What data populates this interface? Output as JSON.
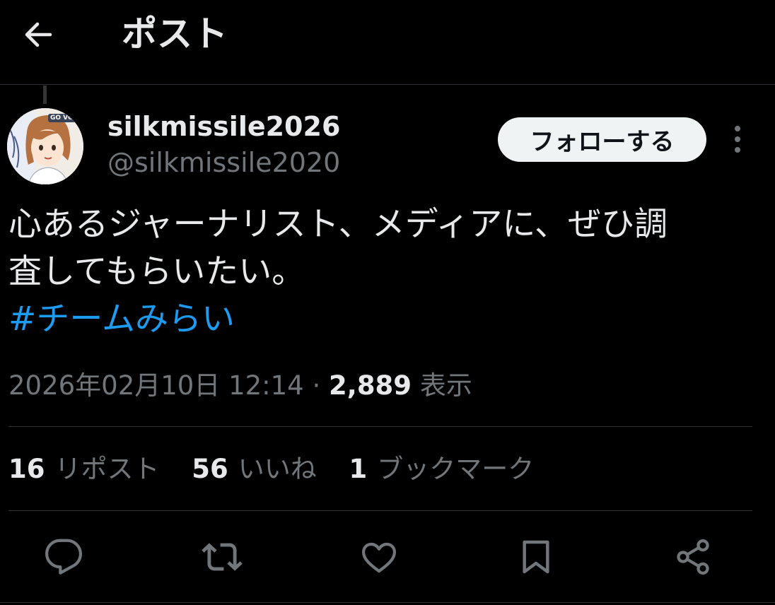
{
  "header": {
    "title": "ポスト",
    "back_icon": "arrow-left-icon"
  },
  "author": {
    "display_name": "silkmissile2026",
    "handle": "@silkmissile2020",
    "avatar_text": "GO VOTE"
  },
  "follow_button": {
    "label": "フォローする"
  },
  "post": {
    "text_line1": "心あるジャーナリスト、メディアに、ぜひ調",
    "text_line2": "査してもらいたい。",
    "hashtag": "#チームみらい"
  },
  "meta": {
    "timestamp": "2026年02月10日 12:14",
    "separator": "·",
    "views_count": "2,889",
    "views_label": "表示"
  },
  "stats": {
    "reposts": {
      "count": "16",
      "label": "リポスト"
    },
    "likes": {
      "count": "56",
      "label": "いいね"
    },
    "bookmarks": {
      "count": "1",
      "label": "ブックマーク"
    }
  },
  "actions": [
    {
      "name": "reply",
      "icon": "comment-icon"
    },
    {
      "name": "repost",
      "icon": "repost-icon"
    },
    {
      "name": "like",
      "icon": "heart-icon"
    },
    {
      "name": "bookmark",
      "icon": "bookmark-icon"
    },
    {
      "name": "share",
      "icon": "share-icon"
    }
  ],
  "colors": {
    "background": "#000000",
    "text_primary": "#e7e9ea",
    "text_secondary": "#71767b",
    "link": "#1d9bf0",
    "divider": "#2f3336",
    "follow_bg": "#eff3f4"
  }
}
